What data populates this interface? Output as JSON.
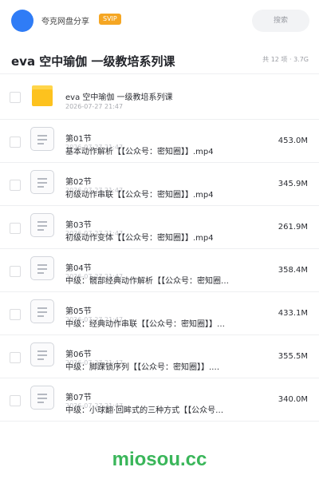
{
  "header": {
    "share_name": "夸克网盘分享",
    "badge": "SVIP",
    "search_label": "搜索"
  },
  "title_bar": {
    "title": "eva 空中瑜伽 一级教培系列课",
    "meta": "共 12 项 · 3.7G"
  },
  "folder": {
    "name": "eva 空中瑜伽 一级教培系列课",
    "date": "2026-07-27 21:47"
  },
  "files": [
    {
      "label": "第01节",
      "date": "2026-07-27 21:47",
      "name": "基本动作解析【【公众号：密知圈】】.mp4",
      "size": "453.0M"
    },
    {
      "label": "第02节",
      "date": "2026-07-27 21:47",
      "name": "初级动作串联【【公众号：密知圈】】.mp4",
      "size": "345.9M"
    },
    {
      "label": "第03节",
      "date": "2026-07-27 21:47",
      "name": "初级动作变体【【公众号：密知圈】】.mp4",
      "size": "261.9M"
    },
    {
      "label": "第04节",
      "date": "2026-07-27 21:47",
      "name": "中级：髋部经典动作解析【【公众号：密知圈…",
      "size": "358.4M"
    },
    {
      "label": "第05节",
      "date": "2026-07-27 21:47",
      "name": "中级：经典动作串联【【公众号：密知圈】】…",
      "size": "433.1M"
    },
    {
      "label": "第06节",
      "date": "2026-07-27 21:47",
      "name": "中级：脚踝锁序列【【公众号：密知圈】】.…",
      "size": "355.5M"
    },
    {
      "label": "第07节",
      "date": "2026-07-27 21:47",
      "name": "中级：小球翻·回眸式的三种方式【【公众号…",
      "size": "340.0M"
    }
  ],
  "watermark": "miosou.cc",
  "colors": {
    "avatar": "#2f7cf6",
    "badge": "#f5a623",
    "folder": "#fdc21e",
    "watermark": "#3ab65a"
  }
}
